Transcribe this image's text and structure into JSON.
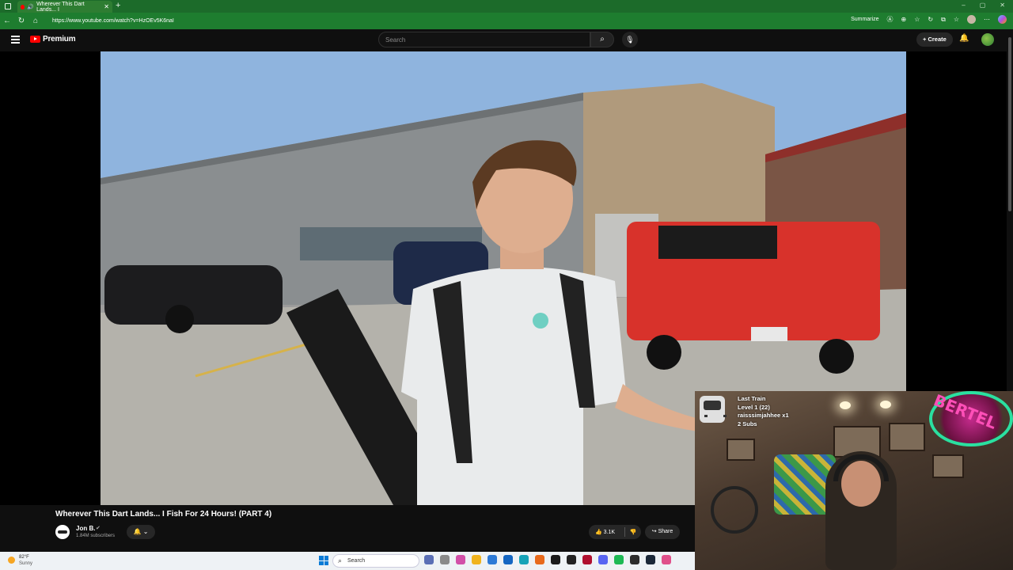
{
  "browser": {
    "tab_title": "Wherever This Dart Lands... I",
    "url": "https://www.youtube.com/watch?v=HzOEv5K6naI",
    "summarize_label": "Summarize"
  },
  "youtube": {
    "logo_text": "Premium",
    "search_placeholder": "Search",
    "create_label": "Create"
  },
  "video": {
    "title": "Wherever This Dart Lands... I Fish For 24 Hours! (PART 4)",
    "channel_name": "Jon B.",
    "subscribers": "1.84M subscribers",
    "likes": "3.1K",
    "share_label": "Share"
  },
  "overlay": {
    "line1": "Last Train",
    "line2": "Level 1  (22)",
    "line3": "raisssimjahhee x1",
    "line4": "2 Subs",
    "neon_text": "BERTEL"
  },
  "taskbar": {
    "temperature": "82°F",
    "condition": "Sunny",
    "search_label": "Search"
  },
  "colors": {
    "chrome_green": "#1e7d2f",
    "yt_red": "#ff0000",
    "yt_bg": "#0f0f0f"
  }
}
